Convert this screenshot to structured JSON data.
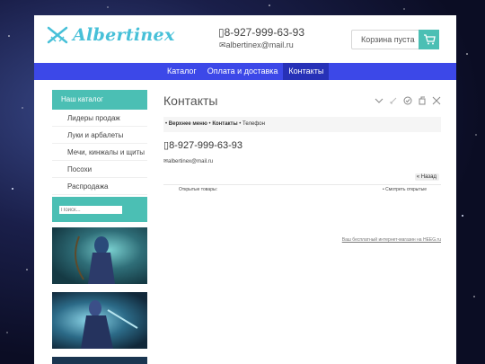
{
  "header": {
    "logo_text": "Albertinex",
    "phone": "8-927-999-63-93",
    "email": "albertinex@mail.ru",
    "cart_label": "Корзина пуста"
  },
  "nav": {
    "items": [
      {
        "label": "Каталог"
      },
      {
        "label": "Оплата и доставка"
      },
      {
        "label": "Контакты",
        "active": true
      }
    ]
  },
  "sidebar": {
    "catalog_title": "Наш каталог",
    "items": [
      {
        "label": "Лидеры продаж"
      },
      {
        "label": "Луки и арбалеты"
      },
      {
        "label": "Мечи, кинжалы и щиты"
      },
      {
        "label": "Посохи"
      },
      {
        "label": "Распродажа"
      }
    ],
    "search_placeholder": "Поиск..."
  },
  "main": {
    "title": "Контакты",
    "breadcrumb": {
      "item1": "Верхнее меню",
      "item2": "Контакты",
      "item3": "Телефон"
    },
    "content_phone": "8-927-999-63-93",
    "content_email": "albertinex@mail.ru",
    "back_label": "Назад",
    "opened_goods_label": "Открытые товары:",
    "opened_goods_link": "Смотреть открытые",
    "footer_note": "Ваш бесплатный интернет-магазин на HEEG.ru"
  },
  "colors": {
    "accent": "#4bbfb4",
    "nav": "#3c48e8",
    "logo": "#47c0d8"
  }
}
